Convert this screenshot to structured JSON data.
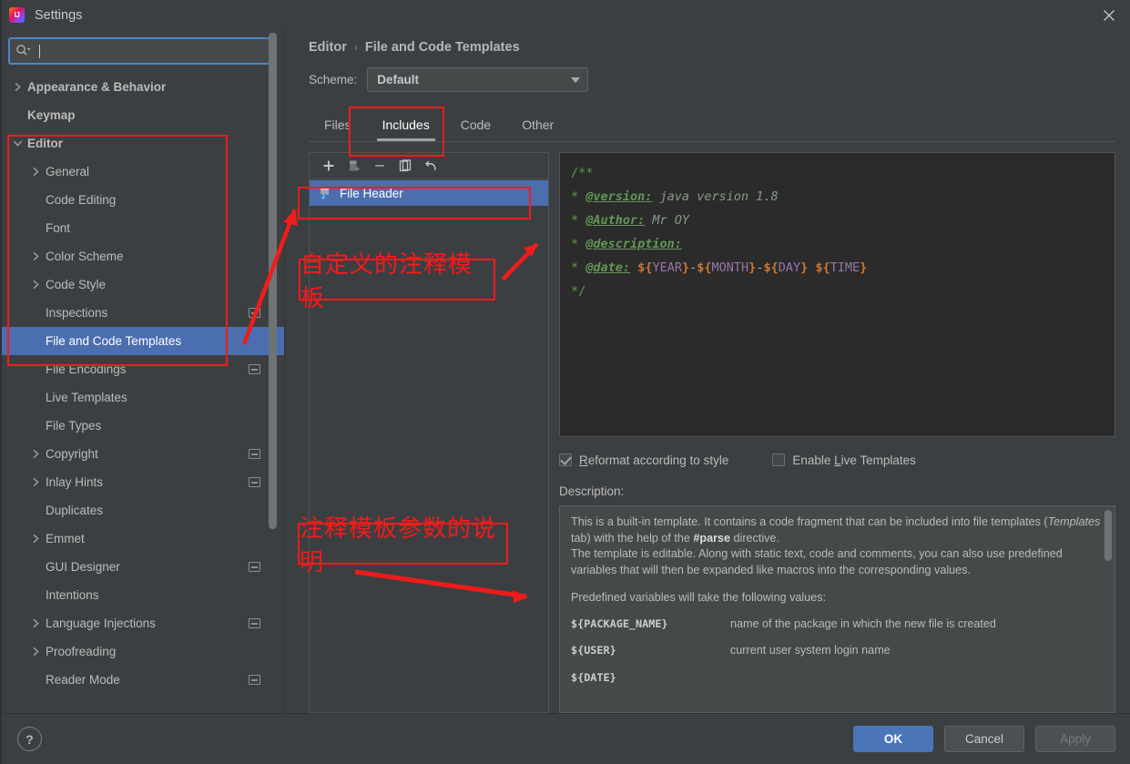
{
  "window": {
    "title": "Settings",
    "app_icon": "intellij-idea-icon",
    "close_icon": "close-icon"
  },
  "search": {
    "value": "",
    "placeholder": "",
    "icon": "search-icon"
  },
  "sidebar": {
    "items": [
      {
        "label": "Appearance & Behavior",
        "level": 0,
        "arrow": "chevron-right",
        "bold": true,
        "selected": false,
        "badge": false
      },
      {
        "label": "Keymap",
        "level": 0,
        "arrow": "none",
        "bold": true,
        "selected": false,
        "badge": false
      },
      {
        "label": "Editor",
        "level": 0,
        "arrow": "chevron-down",
        "bold": true,
        "selected": false,
        "badge": false
      },
      {
        "label": "General",
        "level": 1,
        "arrow": "chevron-right",
        "bold": false,
        "selected": false,
        "badge": false
      },
      {
        "label": "Code Editing",
        "level": 1,
        "arrow": "none",
        "bold": false,
        "selected": false,
        "badge": false
      },
      {
        "label": "Font",
        "level": 1,
        "arrow": "none",
        "bold": false,
        "selected": false,
        "badge": false
      },
      {
        "label": "Color Scheme",
        "level": 1,
        "arrow": "chevron-right",
        "bold": false,
        "selected": false,
        "badge": false
      },
      {
        "label": "Code Style",
        "level": 1,
        "arrow": "chevron-right",
        "bold": false,
        "selected": false,
        "badge": false
      },
      {
        "label": "Inspections",
        "level": 1,
        "arrow": "none",
        "bold": false,
        "selected": false,
        "badge": true
      },
      {
        "label": "File and Code Templates",
        "level": 1,
        "arrow": "none",
        "bold": false,
        "selected": true,
        "badge": false
      },
      {
        "label": "File Encodings",
        "level": 1,
        "arrow": "none",
        "bold": false,
        "selected": false,
        "badge": true
      },
      {
        "label": "Live Templates",
        "level": 1,
        "arrow": "none",
        "bold": false,
        "selected": false,
        "badge": false
      },
      {
        "label": "File Types",
        "level": 1,
        "arrow": "none",
        "bold": false,
        "selected": false,
        "badge": false
      },
      {
        "label": "Copyright",
        "level": 1,
        "arrow": "chevron-right",
        "bold": false,
        "selected": false,
        "badge": true
      },
      {
        "label": "Inlay Hints",
        "level": 1,
        "arrow": "chevron-right",
        "bold": false,
        "selected": false,
        "badge": true
      },
      {
        "label": "Duplicates",
        "level": 1,
        "arrow": "none",
        "bold": false,
        "selected": false,
        "badge": false
      },
      {
        "label": "Emmet",
        "level": 1,
        "arrow": "chevron-right",
        "bold": false,
        "selected": false,
        "badge": false
      },
      {
        "label": "GUI Designer",
        "level": 1,
        "arrow": "none",
        "bold": false,
        "selected": false,
        "badge": true
      },
      {
        "label": "Intentions",
        "level": 1,
        "arrow": "none",
        "bold": false,
        "selected": false,
        "badge": false
      },
      {
        "label": "Language Injections",
        "level": 1,
        "arrow": "chevron-right",
        "bold": false,
        "selected": false,
        "badge": true
      },
      {
        "label": "Proofreading",
        "level": 1,
        "arrow": "chevron-right",
        "bold": false,
        "selected": false,
        "badge": false
      },
      {
        "label": "Reader Mode",
        "level": 1,
        "arrow": "none",
        "bold": false,
        "selected": false,
        "badge": true
      }
    ]
  },
  "breadcrumb": {
    "parent": "Editor",
    "separator": "›",
    "current": "File and Code Templates"
  },
  "scheme": {
    "label": "Scheme:",
    "value": "Default",
    "icon": "chevron-down-icon"
  },
  "tabs": [
    {
      "label": "Files",
      "active": false
    },
    {
      "label": "Includes",
      "active": true
    },
    {
      "label": "Code",
      "active": false
    },
    {
      "label": "Other",
      "active": false
    }
  ],
  "list_toolbar": [
    {
      "name": "add-template-button",
      "icon": "plus-icon"
    },
    {
      "name": "copy-template-button",
      "icon": "copy-file-icon"
    },
    {
      "name": "remove-template-button",
      "icon": "minus-icon"
    },
    {
      "name": "duplicate-template-button",
      "icon": "duplicate-icon"
    },
    {
      "name": "reset-template-button",
      "icon": "undo-arrow-icon"
    }
  ],
  "template_list": [
    {
      "label": "File Header",
      "selected": true,
      "icon": "java-file-icon"
    }
  ],
  "code": {
    "lines": [
      [
        {
          "t": "/**",
          "c": "c-com"
        }
      ],
      [
        {
          "t": "* ",
          "c": "c-com"
        },
        {
          "t": "@version:",
          "c": "c-tag"
        },
        {
          "t": " java version 1.8",
          "c": "c-txt"
        }
      ],
      [
        {
          "t": "* ",
          "c": "c-com"
        },
        {
          "t": "@Author:",
          "c": "c-tag"
        },
        {
          "t": " Mr OY",
          "c": "c-txt"
        }
      ],
      [
        {
          "t": "* ",
          "c": "c-com"
        },
        {
          "t": "@description:",
          "c": "c-tag"
        }
      ],
      [
        {
          "t": "* ",
          "c": "c-com"
        },
        {
          "t": "@date:",
          "c": "c-tag"
        },
        {
          "t": " ",
          "c": "c-txt"
        },
        {
          "t": "${",
          "c": "c-var-d"
        },
        {
          "t": "YEAR",
          "c": "c-var-n"
        },
        {
          "t": "}",
          "c": "c-var-d"
        },
        {
          "t": "-",
          "c": "c-dash"
        },
        {
          "t": "${",
          "c": "c-var-d"
        },
        {
          "t": "MONTH",
          "c": "c-var-n"
        },
        {
          "t": "}",
          "c": "c-var-d"
        },
        {
          "t": "-",
          "c": "c-dash"
        },
        {
          "t": "${",
          "c": "c-var-d"
        },
        {
          "t": "DAY",
          "c": "c-var-n"
        },
        {
          "t": "}",
          "c": "c-var-d"
        },
        {
          "t": " ",
          "c": "c-txt"
        },
        {
          "t": "${",
          "c": "c-var-d"
        },
        {
          "t": "TIME",
          "c": "c-var-n"
        },
        {
          "t": "}",
          "c": "c-var-d"
        }
      ],
      [
        {
          "t": "*/",
          "c": "c-com"
        }
      ]
    ],
    "raw": "/**\n * @version: java version 1.8\n * @Author: Mr OY\n * @description:\n * @date: ${YEAR}-${MONTH}-${DAY} ${TIME}\n */"
  },
  "options": {
    "reformat": {
      "label_pre": "",
      "label_mnemonic": "R",
      "label_post": "eformat according to style",
      "checked": true
    },
    "live_templates": {
      "label_pre": "Enable ",
      "label_mnemonic": "L",
      "label_post": "ive Templates",
      "checked": false
    }
  },
  "description": {
    "label": "Description:",
    "paragraph1_a": "This is a built-in template. It contains a code fragment that can be included into file templates (",
    "paragraph1_em": "Templates",
    "paragraph1_b": " tab) with the help of the ",
    "paragraph1_bold": "#parse",
    "paragraph1_c": " directive.",
    "paragraph2": "The template is editable. Along with static text, code and comments, you can also use predefined variables that will then be expanded like macros into the corresponding values.",
    "paragraph3": "Predefined variables will take the following values:",
    "variables": [
      {
        "name": "${PACKAGE_NAME}",
        "desc": "name of the package in which the new file is created"
      },
      {
        "name": "${USER}",
        "desc": "current user system login name"
      },
      {
        "name": "${DATE}",
        "desc": ""
      }
    ]
  },
  "footer": {
    "help_icon": "question-mark-icon",
    "ok": "OK",
    "cancel": "Cancel",
    "apply": "Apply",
    "apply_disabled": true
  },
  "annotations": {
    "note1": "自定义的注释模板",
    "note2": "注释模板参数的说明",
    "color": "#f21b1b"
  },
  "colors": {
    "dialog_bg": "#3c3f41",
    "editor_bg": "#2b2b2b",
    "selection": "#4b6eaf",
    "accent_button": "#4a76b8",
    "focus_ring": "#4a88c7",
    "annotation_red": "#f21b1b"
  }
}
